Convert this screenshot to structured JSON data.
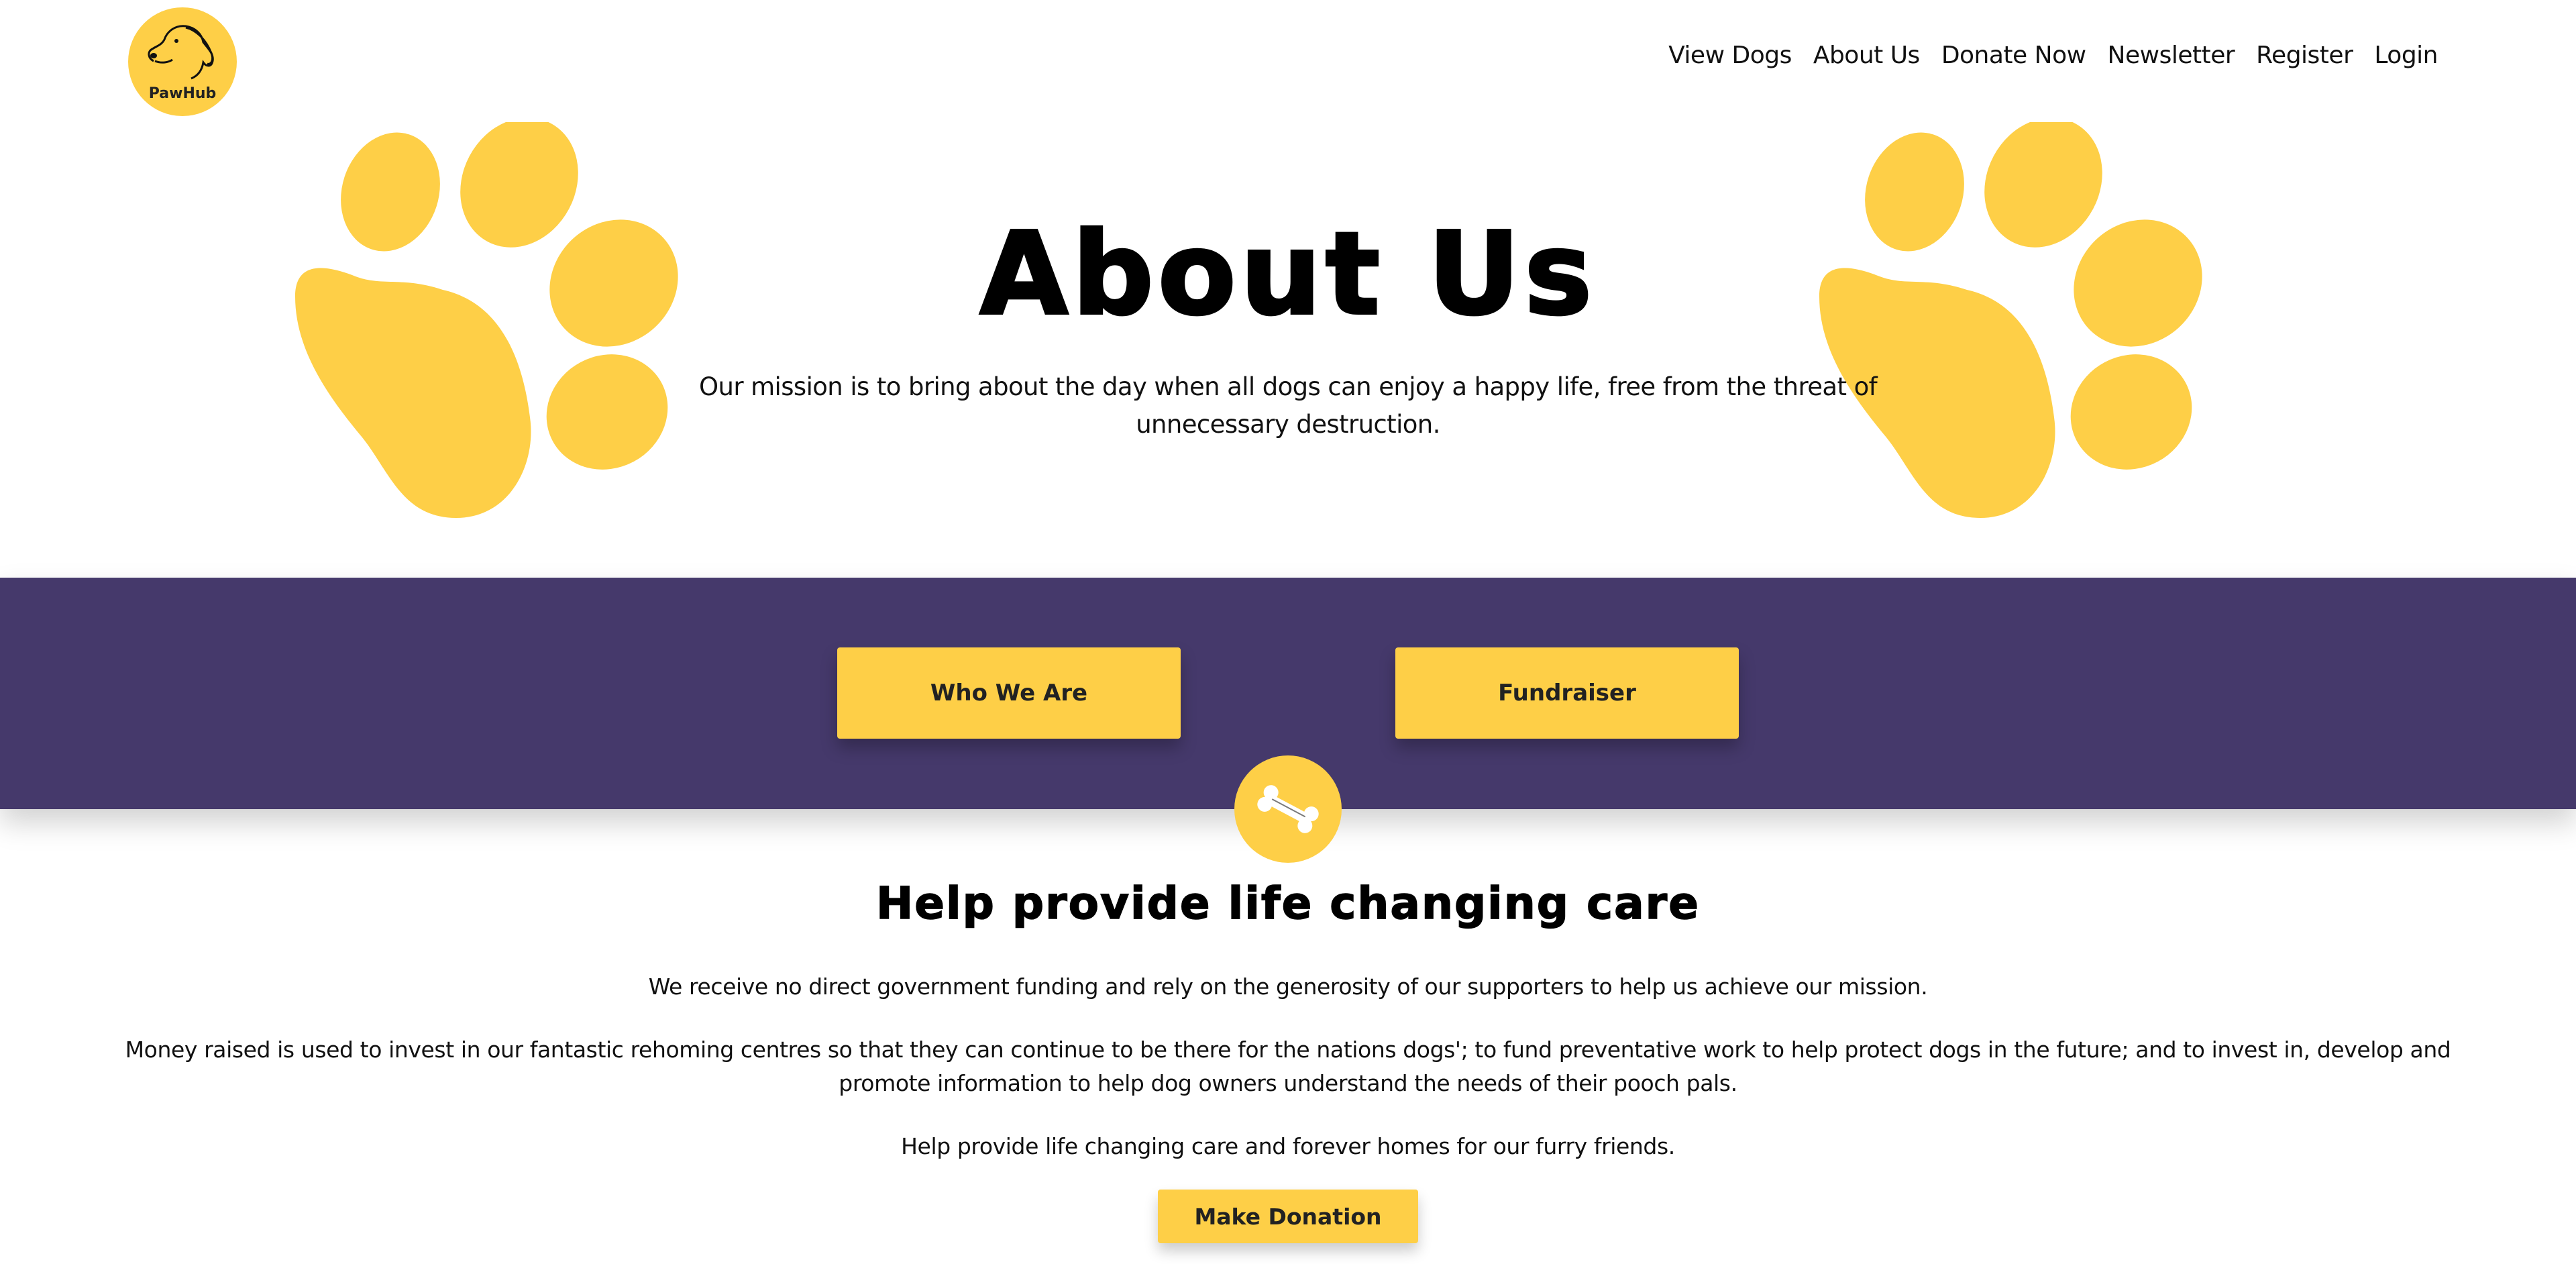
{
  "brand": {
    "logo_text": "PawHub",
    "accent": "#fecf47",
    "band_color": "#45396b"
  },
  "nav": {
    "items": [
      {
        "label": "View Dogs"
      },
      {
        "label": "About Us"
      },
      {
        "label": "Donate Now"
      },
      {
        "label": "Newsletter"
      },
      {
        "label": "Register"
      },
      {
        "label": "Login"
      }
    ]
  },
  "hero": {
    "title": "About Us",
    "text": "Our mission is to bring about the day when all dogs can enjoy a happy life, free from the threat of unnecessary destruction."
  },
  "band": {
    "buttons": [
      {
        "label": "Who We Are"
      },
      {
        "label": "Fundraiser"
      }
    ],
    "badge_icon": "bone-icon"
  },
  "care": {
    "title": "Help provide life changing care",
    "paragraphs": [
      "We receive no direct government funding and rely on the generosity of our supporters to help us achieve our mission.",
      "Money raised is used to invest in our fantastic rehoming centres so that they can continue to be there for the nations dogs'; to fund preventative work to help protect dogs in the future; and to invest in, develop and promote information to help dog owners understand the needs of their pooch pals.",
      "Help provide life changing care and forever homes for our furry friends."
    ],
    "donate_label": "Make Donation"
  }
}
